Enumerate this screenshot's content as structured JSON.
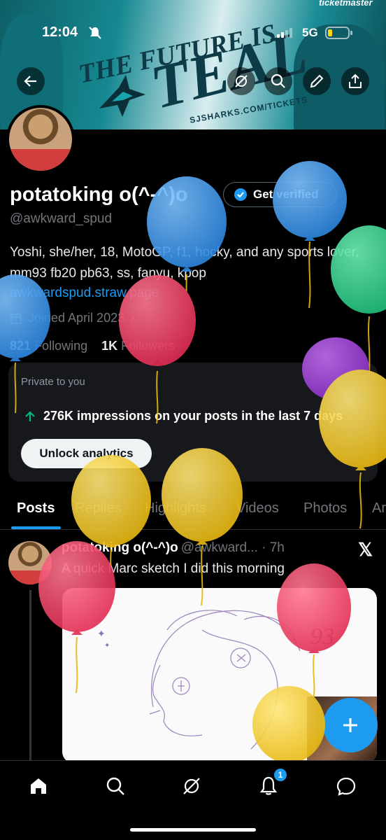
{
  "status_bar": {
    "time": "12:04",
    "network": "5G"
  },
  "banner": {
    "headline": "THE FUTURE IS",
    "headline_big": "TEAL",
    "site": "SJSHARKS.COM/TICKETS",
    "sponsor": "ticketmaster"
  },
  "profile": {
    "name": "potatoking o(^-^)o",
    "verify_label": "Get verified",
    "handle": "@awkward_spud",
    "bio": "Yoshi, she/her, 18, MotoGP, f1, hocky, and any sports lover, mm93 fb20 pb63, ss, fanyu, kpop",
    "link": "awkwardspud.straw.page",
    "joined": "Joined April 2023",
    "following_count": "821",
    "following_label": "Following",
    "followers_count": "1K",
    "followers_label": "Followers"
  },
  "analytics": {
    "private_label": "Private to you",
    "impressions": "276K impressions on your posts in the last 7 days",
    "unlock_label": "Unlock analytics"
  },
  "tabs": [
    "Posts",
    "Replies",
    "Highlights",
    "Videos",
    "Photos",
    "Ar"
  ],
  "tweet": {
    "name": "potatoking o(^-^)o",
    "meta": "@awkward... · 7h",
    "text": "A quick Marc sketch I did this morning",
    "sketch_text": "93"
  },
  "nav": {
    "notifications_badge": "1"
  },
  "colors": {
    "accent": "#1d9bf0",
    "background": "#000000",
    "card": "#16181c"
  },
  "icons": [
    "back-icon",
    "hide-icon",
    "search-icon",
    "edit-icon",
    "share-icon",
    "verified-badge-icon",
    "calendar-icon",
    "arrow-up-icon",
    "x-logo-icon",
    "plus-icon",
    "home-icon",
    "explore-icon",
    "grok-icon",
    "bell-icon",
    "messages-icon"
  ]
}
